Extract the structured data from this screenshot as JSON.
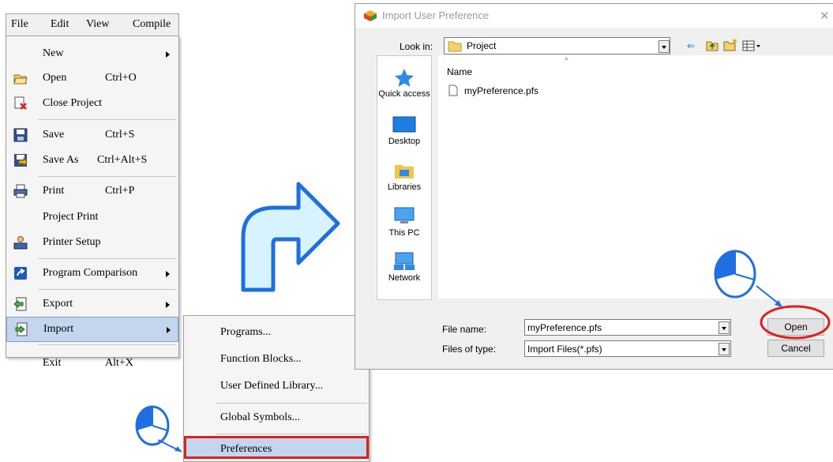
{
  "menubar": {
    "file": "File",
    "edit": "Edit",
    "view": "View",
    "compile": "Compile"
  },
  "file_menu": {
    "new": "New",
    "open": "Open",
    "open_shortcut": "Ctrl+O",
    "close_project": "Close Project",
    "save": "Save",
    "save_shortcut": "Ctrl+S",
    "save_as": "Save As",
    "save_as_shortcut": "Ctrl+Alt+S",
    "print": "Print",
    "print_shortcut": "Ctrl+P",
    "project_print": "Project Print",
    "printer_setup": "Printer Setup",
    "program_comparison": "Program Comparison",
    "export": "Export",
    "import": "Import",
    "exit": "Exit",
    "exit_shortcut": "Alt+X"
  },
  "import_submenu": {
    "programs": "Programs...",
    "function_blocks": "Function Blocks...",
    "user_defined_library": "User Defined Library...",
    "global_symbols": "Global Symbols...",
    "preferences": "Preferences"
  },
  "dialog": {
    "title": "Import User Preference",
    "look_in_label": "Look in:",
    "look_in_value": "Project",
    "places": [
      "Quick access",
      "Desktop",
      "Libraries",
      "This PC",
      "Network"
    ],
    "column_name": "Name",
    "files": [
      "myPreference.pfs"
    ],
    "file_name_label": "File name:",
    "file_name_value": "myPreference.pfs",
    "files_of_type_label": "Files of type:",
    "files_of_type_value": "Import Files(*.pfs)",
    "open_button": "Open",
    "cancel_button": "Cancel"
  },
  "colors": {
    "highlight": "#c4d6ee",
    "annotation_red": "#e02020",
    "annotation_blue": "#1f6fe0",
    "arrow_fill": "#d6f3ff"
  }
}
